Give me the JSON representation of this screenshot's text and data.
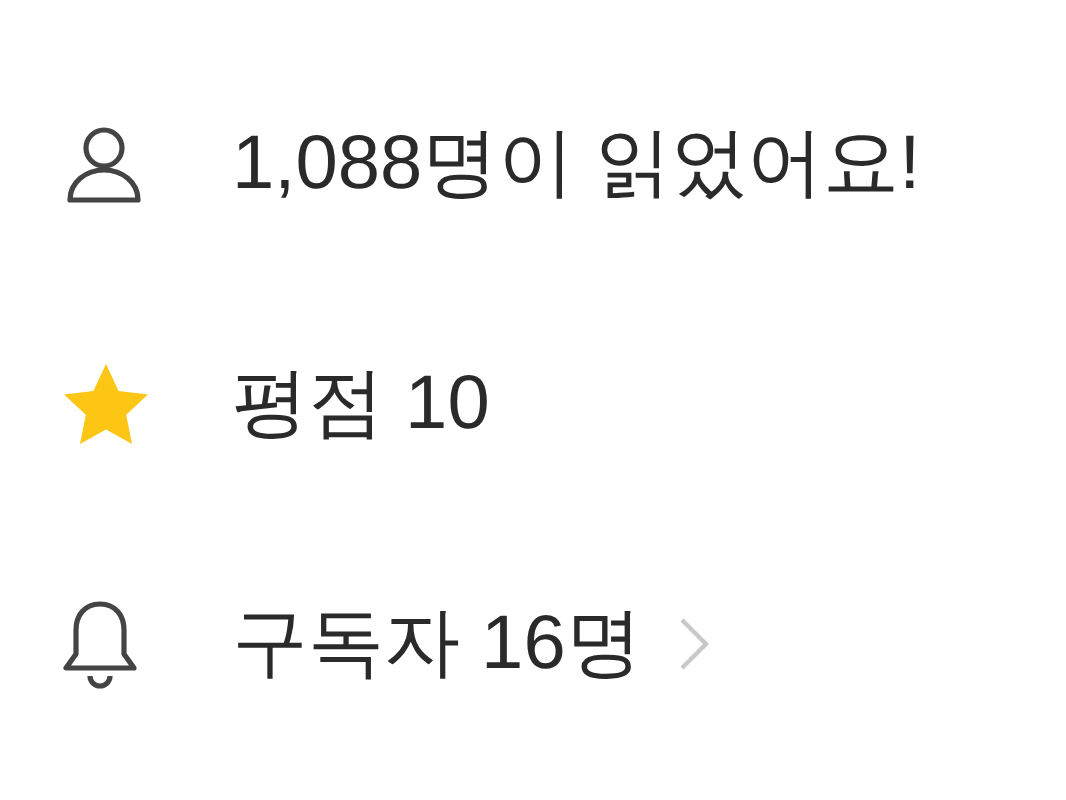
{
  "rows": [
    {
      "kind": "person",
      "text": "1,088명이 읽었어요!",
      "chevron": false
    },
    {
      "kind": "star",
      "text": "평점 10",
      "chevron": false
    },
    {
      "kind": "bell",
      "text": "구독자 16명",
      "chevron": true
    }
  ]
}
